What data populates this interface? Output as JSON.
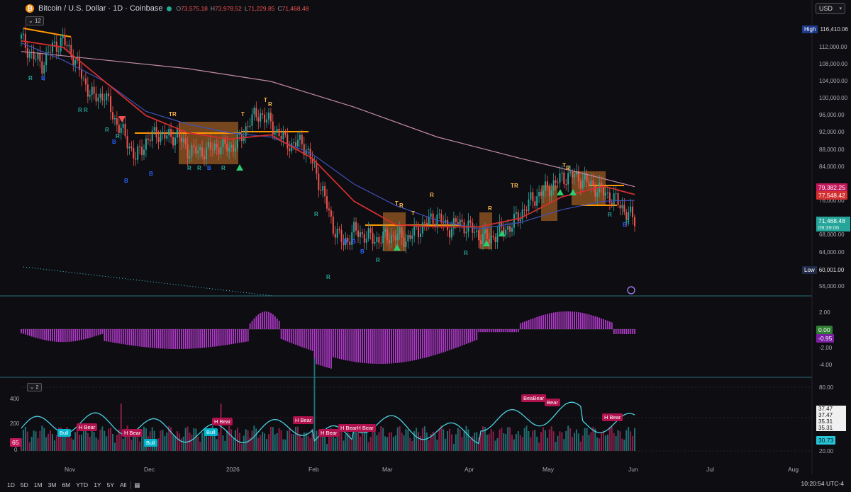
{
  "header": {
    "coin_symbol": "₿",
    "title": "Bitcoin / U.S. Dollar · 1D · Coinbase",
    "ohlc": [
      {
        "k": "O",
        "v": "73,575.18"
      },
      {
        "k": "H",
        "v": "73,978.52"
      },
      {
        "k": "L",
        "v": "71,229.85"
      },
      {
        "k": "C",
        "v": "71,468.48"
      }
    ],
    "indicator_count": "12",
    "pane2_count": "2",
    "currency": "USD"
  },
  "price_axis": {
    "ticks": [
      "112,000.00",
      "108,000.00",
      "104,000.00",
      "100,000.00",
      "96,000.00",
      "92,000.00",
      "88,000.00",
      "84,000.00",
      "76,000.00",
      "68,000.00",
      "64,000.00",
      "56,000.00"
    ],
    "high_label": "High",
    "high_value": "116,410.06",
    "low_label": "Low",
    "low_value": "60,001.00",
    "tag_pink": "79,382.25",
    "tag_red": "77,548.42",
    "last_price": "71,468.48",
    "countdown": "09:39:06"
  },
  "macd_axis": {
    "ticks": [
      "2.00",
      "-2.00",
      "-4.00"
    ],
    "tag_zero": "0.00",
    "tag_value": "-0.95"
  },
  "vol_axis": {
    "left_ticks": [
      "400",
      "200",
      "0"
    ],
    "left_tag": "65",
    "right_ticks": [
      "80.00",
      "20.00"
    ],
    "right_tags": [
      "37.47",
      "37.47",
      "35.31",
      "35.31"
    ],
    "right_tag_last": "30.73"
  },
  "x_axis": [
    "Nov",
    "Dec",
    "2026",
    "Feb",
    "Mar",
    "Apr",
    "May",
    "Jun",
    "Jul",
    "Aug"
  ],
  "timeframes": [
    "1D",
    "5D",
    "1M",
    "3M",
    "6M",
    "YTD",
    "1Y",
    "5Y",
    "All"
  ],
  "clock": "10:20:54 UTC-4",
  "signals": {
    "R": "R",
    "B": "B",
    "T": "T",
    "hbear": "H Bear",
    "bull": "Bull",
    "bear": "Bear",
    "hbeartwo": "H BearH Bear",
    "bearbear": "BeaBear"
  },
  "colors": {
    "bg": "#0d0d12",
    "up": "#26a69a",
    "down": "#ef5350",
    "ma_red": "#d32f2f",
    "ma_blue": "#3f51b5",
    "ma_pink": "#c48aa4",
    "orange": "#ff9800",
    "histogram": "#9c27b0",
    "rsi": "#4dd0e1"
  },
  "chart_data": {
    "type": "candlestick",
    "x_range": [
      "Oct",
      "Jun"
    ],
    "ylim": [
      56000,
      116410.06
    ],
    "close_path": [
      [
        0,
        114000
      ],
      [
        5,
        110000
      ],
      [
        10,
        108000
      ],
      [
        15,
        112000
      ],
      [
        20,
        113500
      ],
      [
        25,
        110000
      ],
      [
        30,
        104000
      ],
      [
        35,
        100000
      ],
      [
        40,
        101000
      ],
      [
        45,
        95000
      ],
      [
        50,
        91000
      ],
      [
        55,
        86000
      ],
      [
        60,
        90000
      ],
      [
        65,
        92000
      ],
      [
        70,
        91000
      ],
      [
        75,
        91500
      ],
      [
        80,
        88000
      ],
      [
        85,
        87500
      ],
      [
        90,
        88000
      ],
      [
        95,
        89000
      ],
      [
        100,
        88500
      ],
      [
        105,
        90000
      ],
      [
        110,
        95000
      ],
      [
        115,
        96500
      ],
      [
        120,
        94000
      ],
      [
        125,
        91000
      ],
      [
        130,
        89000
      ],
      [
        135,
        90000
      ],
      [
        140,
        85000
      ],
      [
        145,
        78000
      ],
      [
        150,
        70000
      ],
      [
        155,
        66000
      ],
      [
        160,
        69000
      ],
      [
        165,
        68000
      ],
      [
        170,
        67000
      ],
      [
        175,
        67500
      ],
      [
        180,
        68000
      ],
      [
        185,
        67000
      ],
      [
        190,
        69000
      ],
      [
        195,
        71000
      ],
      [
        200,
        72500
      ],
      [
        205,
        69500
      ],
      [
        210,
        71000
      ],
      [
        215,
        70000
      ],
      [
        220,
        68000
      ],
      [
        225,
        67000
      ],
      [
        230,
        69000
      ],
      [
        235,
        70000
      ],
      [
        240,
        73000
      ],
      [
        245,
        76000
      ],
      [
        250,
        78000
      ],
      [
        255,
        79500
      ],
      [
        260,
        81500
      ],
      [
        265,
        82000
      ],
      [
        270,
        81000
      ],
      [
        275,
        79500
      ],
      [
        280,
        78000
      ],
      [
        285,
        76500
      ],
      [
        290,
        74000
      ],
      [
        295,
        71468.48
      ]
    ],
    "ma_red": [
      [
        0,
        113500
      ],
      [
        20,
        112000
      ],
      [
        40,
        104000
      ],
      [
        60,
        96000
      ],
      [
        80,
        92000
      ],
      [
        100,
        90500
      ],
      [
        120,
        91500
      ],
      [
        140,
        86000
      ],
      [
        160,
        76000
      ],
      [
        180,
        70500
      ],
      [
        200,
        70000
      ],
      [
        220,
        70000
      ],
      [
        240,
        72000
      ],
      [
        260,
        77000
      ],
      [
        280,
        79500
      ],
      [
        295,
        77548.42
      ]
    ],
    "ma_blue": [
      [
        0,
        113000
      ],
      [
        20,
        109000
      ],
      [
        40,
        104000
      ],
      [
        60,
        97000
      ],
      [
        80,
        94000
      ],
      [
        100,
        92000
      ],
      [
        120,
        91000
      ],
      [
        140,
        87000
      ],
      [
        160,
        80000
      ],
      [
        180,
        75000
      ],
      [
        200,
        71500
      ],
      [
        220,
        69500
      ],
      [
        240,
        71000
      ],
      [
        260,
        74000
      ],
      [
        280,
        76000
      ],
      [
        295,
        76200
      ]
    ],
    "ma_pink": [
      [
        0,
        111000
      ],
      [
        40,
        109000
      ],
      [
        80,
        107000
      ],
      [
        120,
        104000
      ],
      [
        160,
        98000
      ],
      [
        200,
        91000
      ],
      [
        240,
        86000
      ],
      [
        270,
        82500
      ],
      [
        295,
        79382.25
      ]
    ]
  }
}
